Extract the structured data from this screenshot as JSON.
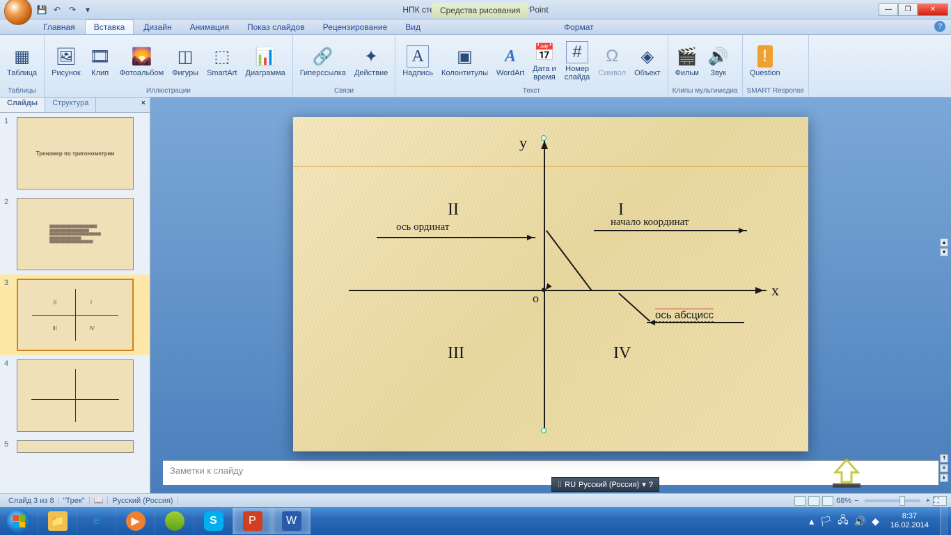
{
  "titlebar": {
    "document_title": "НПК стенд.pptx - Microsoft PowerPoint",
    "drawing_tools": "Средства рисования"
  },
  "ribbon_tabs": {
    "home": "Главная",
    "insert": "Вставка",
    "design": "Дизайн",
    "animation": "Анимация",
    "slideshow": "Показ слайдов",
    "review": "Рецензирование",
    "view": "Вид",
    "format": "Формат"
  },
  "ribbon": {
    "tables": {
      "table": "Таблица",
      "group": "Таблицы"
    },
    "illustrations": {
      "picture": "Рисунок",
      "clip": "Клип",
      "album": "Фотоальбом",
      "shapes": "Фигуры",
      "smartart": "SmartArt",
      "chart": "Диаграмма",
      "group": "Иллюстрации"
    },
    "links": {
      "hyperlink": "Гиперссылка",
      "action": "Действие",
      "group": "Связи"
    },
    "text": {
      "textbox": "Надпись",
      "headerfooter": "Колонтитулы",
      "wordart": "WordArt",
      "datetime": "Дата и\nвремя",
      "slidenum": "Номер\nслайда",
      "symbol": "Символ",
      "object": "Объект",
      "group": "Текст"
    },
    "media": {
      "movie": "Фильм",
      "sound": "Звук",
      "group": "Клипы мультимедиа"
    },
    "smart": {
      "question": "Question",
      "group": "SMART Response"
    }
  },
  "panel": {
    "slides": "Слайды",
    "outline": "Структура"
  },
  "thumbs": {
    "t1": "Тренажер по тригонометрии",
    "t2": "",
    "t3": "",
    "t4": "",
    "t5": ""
  },
  "slide": {
    "y": "y",
    "x": "x",
    "origin": "o",
    "q1": "I",
    "q2": "II",
    "q3": "III",
    "q4": "IV",
    "ordinate": "ось ординат",
    "abscissa": "ось абсцисс",
    "origin_label": "начало координат"
  },
  "notes": {
    "placeholder": "Заметки к слайду"
  },
  "langbar": {
    "code": "RU",
    "name": "Русский (Россия)"
  },
  "status": {
    "slide_info": "Слайд 3 из 8",
    "theme": "\"Трек\"",
    "language": "Русский (Россия)",
    "zoom": "68%"
  },
  "clock": {
    "time": "8:37",
    "date": "16.02.2014"
  },
  "icons": {
    "save": "💾",
    "undo": "↶",
    "redo": "↷",
    "table": "▦",
    "picture": "🖼",
    "clip": "🎞",
    "album": "🌄",
    "shapes": "◫",
    "smartart": "⬚",
    "chart": "📊",
    "link": "🔗",
    "action": "✦",
    "textbox": "A",
    "headerfooter": "▣",
    "wordart": "A",
    "date": "📅",
    "num": "#",
    "symbol": "Ω",
    "object": "◈",
    "movie": "🎬",
    "sound": "🔊",
    "question": "❓"
  }
}
